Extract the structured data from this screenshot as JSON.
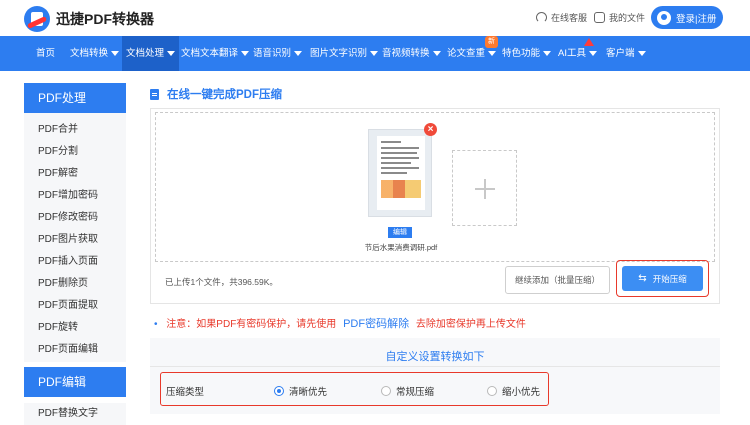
{
  "header": {
    "logo_text": "迅捷PDF转换器",
    "service_link": "在线客服",
    "files_link": "我的文件",
    "login_button": "登录|注册"
  },
  "nav": {
    "items": [
      {
        "label": "首页",
        "has_caret": false
      },
      {
        "label": "文档转换",
        "has_caret": true
      },
      {
        "label": "文档处理",
        "has_caret": true,
        "active": true
      },
      {
        "label": "文档文本翻译",
        "has_caret": true
      },
      {
        "label": "语音识别",
        "has_caret": true
      },
      {
        "label": "图片文字识别",
        "has_caret": true
      },
      {
        "label": "音视频转换",
        "has_caret": true
      },
      {
        "label": "论文查重",
        "has_caret": true
      },
      {
        "label": "特色功能",
        "has_caret": true
      },
      {
        "label": "AI工具",
        "has_caret": true
      },
      {
        "label": "客户端",
        "has_caret": true
      }
    ],
    "new_badge": "新"
  },
  "sidebar": {
    "section1_title": "PDF处理",
    "items": [
      "PDF合并",
      "PDF分割",
      "PDF解密",
      "PDF增加密码",
      "PDF修改密码",
      "PDF图片获取",
      "PDF插入页面",
      "PDF删除页",
      "PDF页面提取",
      "PDF旋转",
      "PDF页面编辑"
    ],
    "section2_title": "PDF编辑",
    "section2_items": [
      "PDF替换文字"
    ]
  },
  "main": {
    "title": "在线一键完成PDF压缩",
    "file": {
      "name": "节后水果消费调研.pdf",
      "edit_label": "编辑",
      "close_glyph": "×"
    },
    "upload_status": "已上传1个文件，共396.59K。",
    "continue_button": "继续添加（批量压缩）",
    "start_button": "开始压缩",
    "notice": {
      "bullet": "•",
      "prefix": "注意：如果PDF有密码保护，请先使用",
      "link": "PDF密码解除",
      "suffix": "去除加密保护再上传文件"
    },
    "settings": {
      "title": "自定义设置转换如下",
      "row_label": "压缩类型",
      "options": [
        {
          "label": "清晰优先",
          "selected": true
        },
        {
          "label": "常规压缩",
          "selected": false
        },
        {
          "label": "缩小优先",
          "selected": false
        }
      ]
    }
  },
  "colors": {
    "primary": "#2d7df0",
    "nav_active": "#1d61c9",
    "highlight": "#e8392b",
    "notice_text": "#e8392b"
  }
}
